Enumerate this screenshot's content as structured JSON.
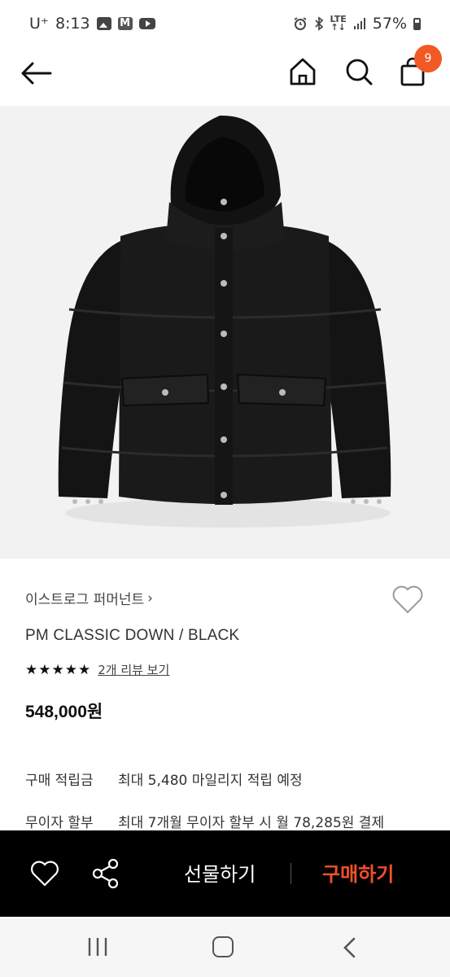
{
  "status_bar": {
    "carrier": "U⁺",
    "time": "8:13",
    "left_icons": [
      "gallery-icon",
      "gmail-icon",
      "youtube-icon"
    ],
    "m_label": "M",
    "right_icons": [
      "alarm-icon",
      "bluetooth-icon",
      "lte-icon",
      "signal-icon"
    ],
    "lte_top": "LTE",
    "lte_bottom": "↑↓",
    "battery": "57%"
  },
  "nav": {
    "icons": [
      "back-arrow-icon",
      "home-icon",
      "search-icon",
      "shopping-bag-icon"
    ],
    "cart_count": "9",
    "accent_color": "#f15a24"
  },
  "product": {
    "image_subject": "jacket",
    "brand": "이스트로그 퍼머넌트",
    "brand_chevron": "›",
    "name": "PM CLASSIC DOWN / BLACK",
    "stars": "★★★★★",
    "rating": 5,
    "review_link": "2개 리뷰 보기",
    "price": "548,000원"
  },
  "details": [
    {
      "label": "구매 적립금",
      "value": "최대 5,480 마일리지 적립 예정"
    },
    {
      "label": "무이자 할부",
      "value": "최대 7개월 무이자 할부 시 월 78,285원 결제"
    }
  ],
  "action_bar": {
    "gift_label": "선물하기",
    "buy_label": "구매하기",
    "buy_color": "#f0502a"
  },
  "system_nav": {
    "icons": [
      "recents-icon",
      "home-circle-icon",
      "back-chevron-icon"
    ]
  }
}
